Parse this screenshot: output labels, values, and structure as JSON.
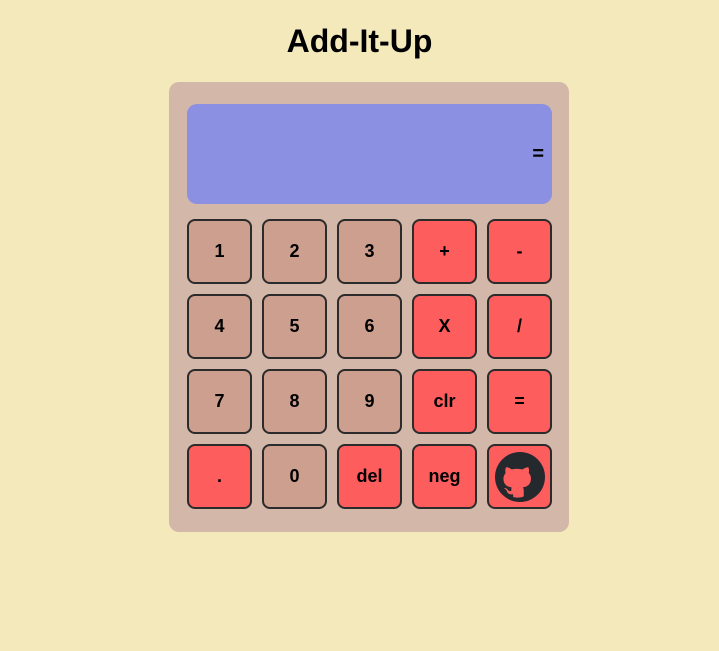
{
  "app": {
    "title": "Add-It-Up"
  },
  "display": {
    "expression": "",
    "result_label": "="
  },
  "keys": {
    "k1": "1",
    "k2": "2",
    "k3": "3",
    "plus": "+",
    "minus": "-",
    "k4": "4",
    "k5": "5",
    "k6": "6",
    "multiply": "X",
    "divide": "/",
    "k7": "7",
    "k8": "8",
    "k9": "9",
    "clear": "clr",
    "equals": "=",
    "decimal": ".",
    "k0": "0",
    "delete": "del",
    "negate": "neg",
    "github_icon": "github-icon"
  },
  "colors": {
    "background": "#f4e9bb",
    "calculator_body": "#d3b7a9",
    "display": "#8c90e2",
    "number_key": "#cd9f8f",
    "operator_key": "#fe5d5e",
    "github_icon": "#24292e"
  }
}
